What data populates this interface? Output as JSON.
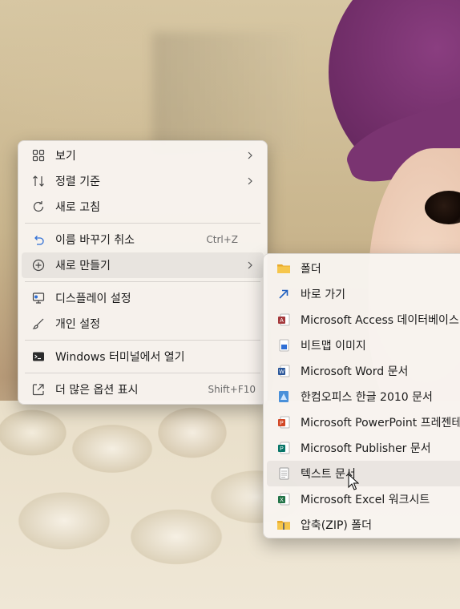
{
  "context_menu": {
    "items": [
      {
        "label": "보기",
        "icon": "view-grid-icon"
      },
      {
        "label": "정렬 기준",
        "icon": "sort-arrows-icon"
      },
      {
        "label": "새로 고침",
        "icon": "refresh-icon"
      },
      {
        "label": "이름 바꾸기 취소",
        "icon": "undo-icon",
        "shortcut": "Ctrl+Z"
      },
      {
        "label": "새로 만들기",
        "icon": "plus-circle-icon"
      },
      {
        "label": "디스플레이 설정",
        "icon": "display-icon"
      },
      {
        "label": "개인 설정",
        "icon": "brush-icon"
      },
      {
        "label": "Windows 터미널에서 열기",
        "icon": "terminal-icon"
      },
      {
        "label": "더 많은 옵션 표시",
        "icon": "expand-icon",
        "shortcut": "Shift+F10"
      }
    ]
  },
  "new_submenu": {
    "items": [
      {
        "label": "폴더",
        "icon": "folder-icon"
      },
      {
        "label": "바로 가기",
        "icon": "shortcut-arrow-icon"
      },
      {
        "label": "Microsoft Access 데이터베이스",
        "icon": "access-icon"
      },
      {
        "label": "비트맵 이미지",
        "icon": "bitmap-icon"
      },
      {
        "label": "Microsoft Word 문서",
        "icon": "word-icon"
      },
      {
        "label": "한컴오피스 한글 2010 문서",
        "icon": "hwp-icon"
      },
      {
        "label": "Microsoft PowerPoint 프레젠테이션",
        "icon": "powerpoint-icon"
      },
      {
        "label": "Microsoft Publisher 문서",
        "icon": "publisher-icon"
      },
      {
        "label": "텍스트 문서",
        "icon": "text-document-icon"
      },
      {
        "label": "Microsoft Excel 워크시트",
        "icon": "excel-icon"
      },
      {
        "label": "압축(ZIP) 폴더",
        "icon": "zip-folder-icon"
      }
    ]
  },
  "colors": {
    "menu_bg": "#f8f4f0",
    "hover_bg": "#ececea",
    "access": "#a4373a",
    "word": "#2b579a",
    "powerpoint": "#d24726",
    "publisher": "#077568",
    "excel": "#217346",
    "folder": "#f4c542"
  }
}
